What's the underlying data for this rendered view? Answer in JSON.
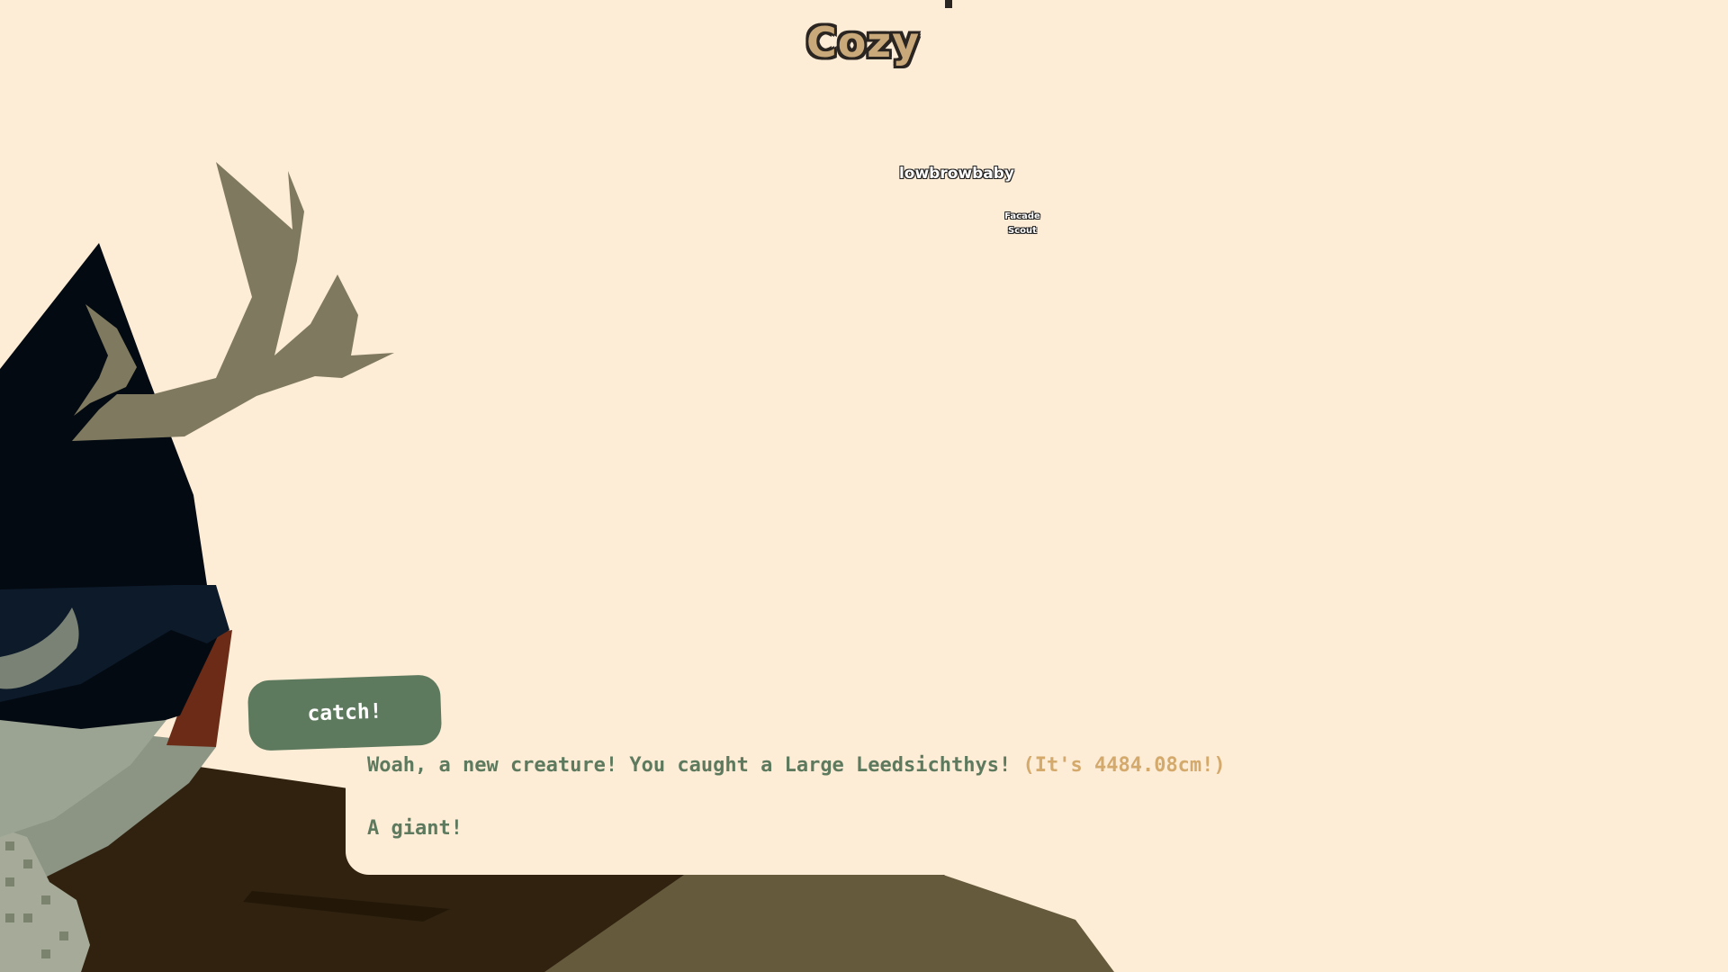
{
  "hud": {
    "area_title": "Cozy",
    "player_name": "lowbrowbaby",
    "player_tag_line1": "Facade",
    "player_tag_line2": "Scout"
  },
  "catch_prompt": {
    "button_label": "catch!"
  },
  "dialog": {
    "line1_text": "Woah, a new creature! You caught a Large Leedsichthys!",
    "line1_size": "(It's 4484.08cm!)",
    "line2_text": "A giant!"
  },
  "colors": {
    "background": "#fdecd6",
    "accent_green": "#5e7a5e",
    "accent_tan": "#d4a96c",
    "character_dark": "#050a10",
    "antler": "#807a60"
  },
  "icons": {
    "character": "deer-antler-cat-character-icon"
  }
}
